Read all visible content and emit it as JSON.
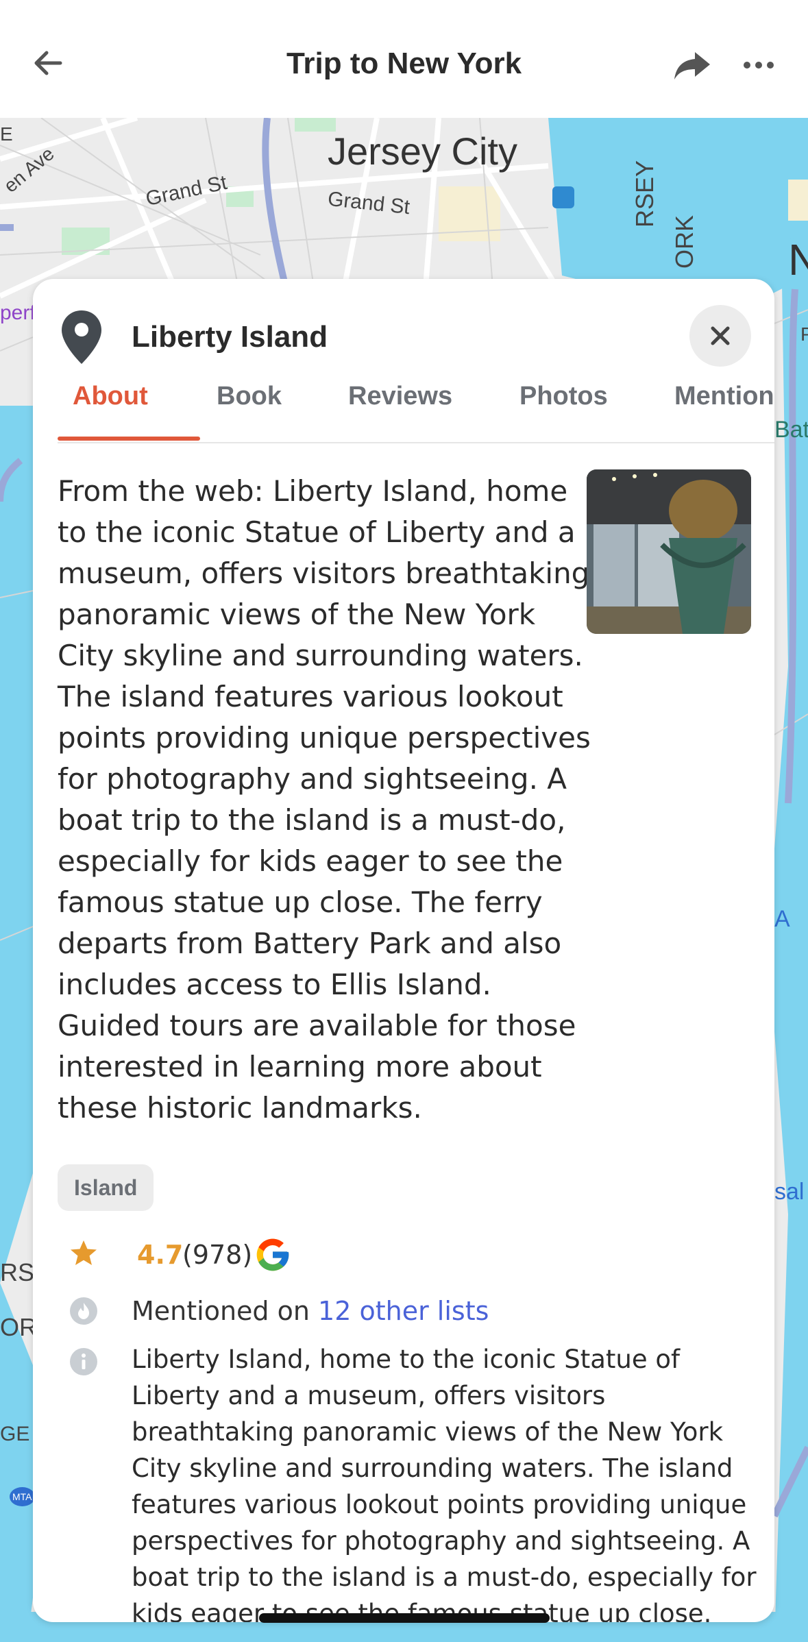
{
  "header": {
    "title": "Trip to New York",
    "back_icon": "arrow-left-icon",
    "share_icon": "share-icon",
    "more_icon": "more-horizontal-icon"
  },
  "map": {
    "labels": {
      "jersey_city": "Jersey City",
      "grand_st_1": "Grand St",
      "grand_st_2": "Grand St",
      "jen_ave": "en Ave",
      "e_frag": "E",
      "perf_frag": "perf",
      "rsey_frag": "RSEY",
      "ork_frag": "ORK",
      "n_frag": "N",
      "p_frag": "P",
      "batt_frag": "Batt",
      "a_frag": "A",
      "sal_frag": "sal",
      "rs_frag": "RS",
      "or_frag": "OR",
      "ge_frag": "GE",
      "mta": "MTA"
    },
    "colors": {
      "water": "#7ed3ef",
      "land": "#ececec",
      "park": "#c8ecd0",
      "road": "#ffffff",
      "highway": "#9aa8d8"
    }
  },
  "card": {
    "place_icon": "map-pin-icon",
    "title": "Liberty Island",
    "close_icon": "close-icon",
    "tabs": [
      {
        "label": "About",
        "active": true
      },
      {
        "label": "Book",
        "active": false
      },
      {
        "label": "Reviews",
        "active": false
      },
      {
        "label": "Photos",
        "active": false
      },
      {
        "label": "Mention",
        "active": false
      }
    ],
    "about_text": "From the web: Liberty Island, home to the iconic Statue of Liberty and a museum, offers visitors breathtaking panoramic views of the New York City skyline and surrounding waters. The island features various lookout points providing unique perspectives for photography and sightseeing. A boat trip to the island is a must-do, especially for kids eager to see the famous statue up close. The ferry departs from Battery Park and also includes access to Ellis Island. Guided tours are available for those interested in learning more about these historic landmarks.",
    "tag": "Island",
    "rating": {
      "value": "4.7",
      "count": "(978)",
      "icon": "star-icon",
      "source_icon": "google-logo"
    },
    "mention": {
      "prefix": "Mentioned on ",
      "link": "12 other lists",
      "icon": "flame-icon"
    },
    "description": "Liberty Island, home to the iconic Statue of Liberty and a museum, offers visitors breathtaking panoramic views of the New York City skyline and surrounding waters. The island features various lookout points providing unique perspectives for photography and sightseeing. A boat trip to the island is a must-do, especially for kids eager to see the famous statue up close. The ferry departs from",
    "description_icon": "info-icon"
  },
  "colors": {
    "accent": "#e0583a",
    "link": "#4a62d8",
    "rating": "#e69a2e"
  }
}
